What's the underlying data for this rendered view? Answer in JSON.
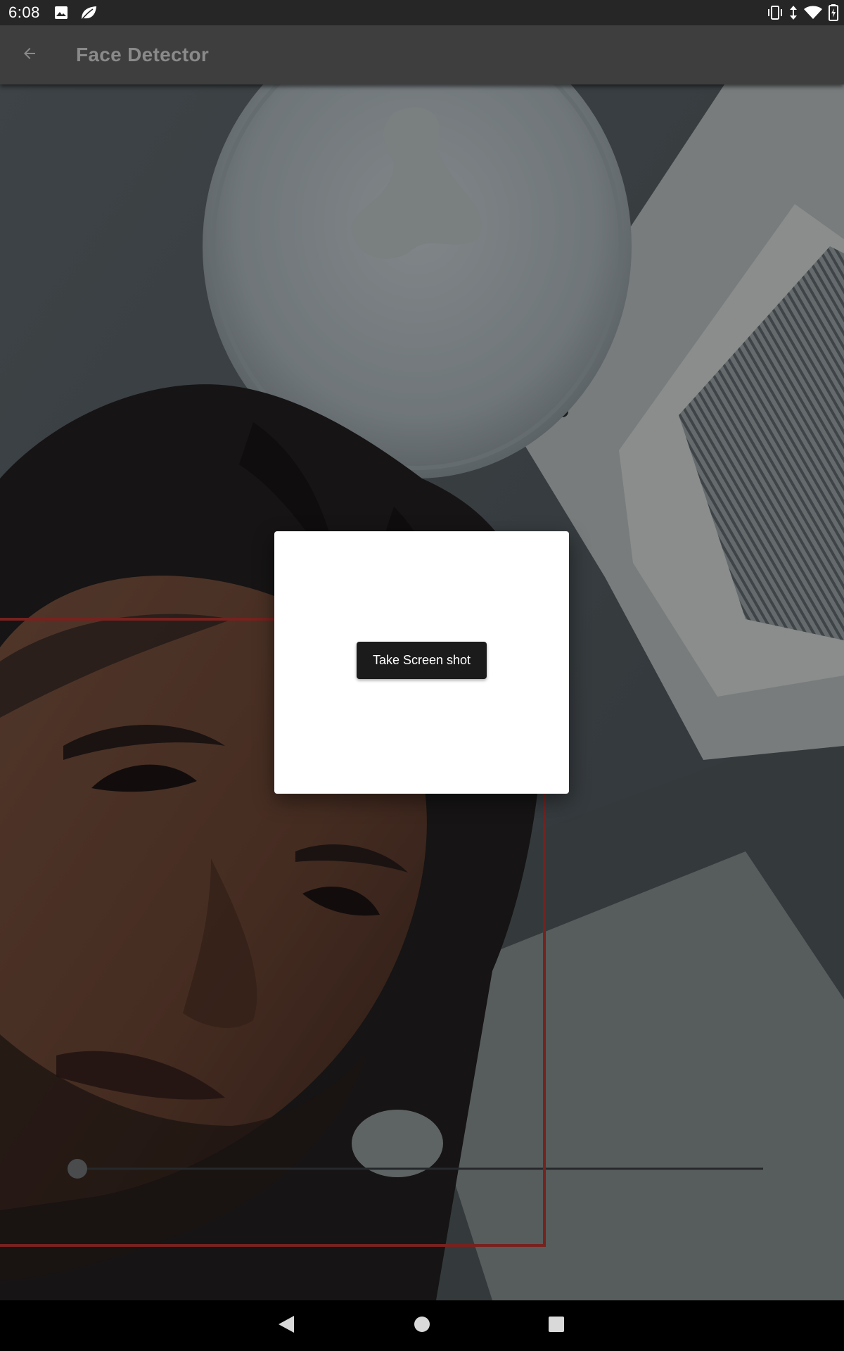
{
  "status_bar": {
    "time": "6:08",
    "left_icons": [
      "image-icon",
      "leaf-icon"
    ],
    "right_icons": [
      "vibrate-icon",
      "data-arrows-icon",
      "wifi-icon",
      "battery-charging-icon"
    ]
  },
  "app_bar": {
    "title": "Face Detector",
    "back_icon": "arrow-back-icon"
  },
  "camera": {
    "face_box_color": "#8e2a28"
  },
  "dialog": {
    "button_label": "Take Screen shot"
  },
  "nav_bar": {
    "icons": [
      "back-triangle-icon",
      "home-circle-icon",
      "recents-square-icon"
    ]
  },
  "colors": {
    "status_bar": "#262626",
    "app_bar": "#3e3e3e",
    "title_text": "#8a8a8a",
    "button_bg": "#1b1b1b",
    "dialog_bg": "#ffffff",
    "nav_bar": "#000000"
  }
}
